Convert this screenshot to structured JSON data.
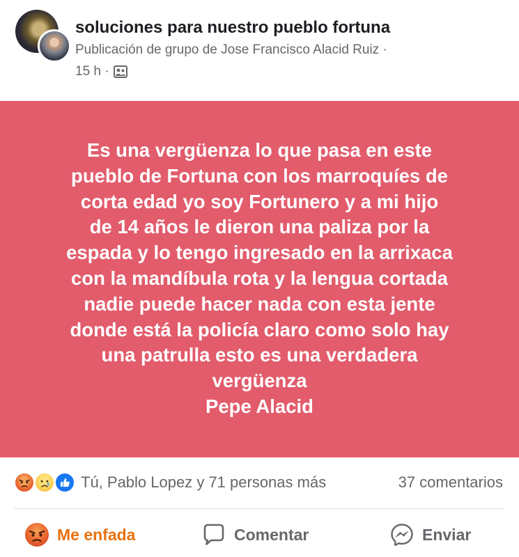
{
  "header": {
    "group_name": "soluciones para nuestro pueblo fortuna",
    "meta_line": "Publicación de grupo de Jose Francisco Alacid Ruiz ·",
    "time": "15 h ·"
  },
  "post": {
    "lines": [
      "Es una vergüenza lo que pasa en este",
      "pueblo de Fortuna con los marroquíes de",
      "corta edad  yo  soy Fortunero y a mi hijo",
      "de 14 años le dieron una paliza por la",
      "espada y lo tengo ingresado en la arrixaca",
      "con la mandíbula rota y la lengua cortada",
      "nadie puede hacer nada con esta jente",
      "donde está la policía claro como solo hay",
      "una patrulla esto es una verdadera",
      "vergüenza",
      "Pepe Alacid"
    ],
    "background_color": "#e25c6c"
  },
  "reactions": {
    "icons": [
      "angry-reaction-icon",
      "sad-reaction-icon",
      "like-reaction-icon"
    ],
    "names_text": "Tú, Pablo Lopez y 71 personas más",
    "comments_text": "37 comentarios"
  },
  "actions": {
    "react_label": "Me enfada",
    "comment_label": "Comentar",
    "share_label": "Enviar"
  },
  "colors": {
    "accent_reaction": "#e9710f",
    "muted_text": "#65676b",
    "like_blue": "#1877f2"
  }
}
